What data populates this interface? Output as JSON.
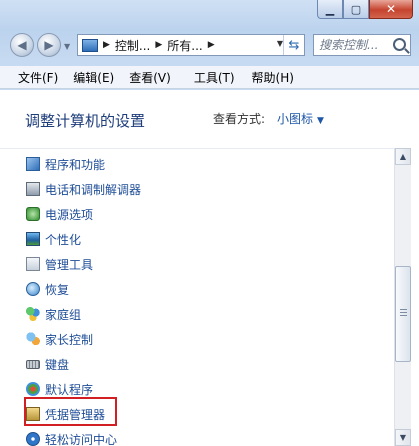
{
  "window": {
    "caption_icons": [
      "minimize-icon",
      "maximize-icon",
      "close-icon"
    ]
  },
  "nav": {
    "back_icon": "back-arrow-icon",
    "forward_icon": "forward-arrow-icon",
    "breadcrumbs": [
      "控制...",
      "所有..."
    ],
    "search_placeholder": "搜索控制..."
  },
  "menu": {
    "items": [
      "文件(F)",
      "编辑(E)",
      "查看(V)",
      "工具(T)",
      "帮助(H)"
    ]
  },
  "content": {
    "heading": "调整计算机的设置",
    "view_label": "查看方式:",
    "view_value": "小图标"
  },
  "list": {
    "items": [
      {
        "label": "程序和功能",
        "icon": "programs-features-icon",
        "color": "#4a7fc1"
      },
      {
        "label": "电话和调制解调器",
        "icon": "phone-modem-icon",
        "color": "#6b7d91"
      },
      {
        "label": "电源选项",
        "icon": "power-options-icon",
        "color": "#3a9a3a"
      },
      {
        "label": "个性化",
        "icon": "personalization-icon",
        "color": "#3b8fd8"
      },
      {
        "label": "管理工具",
        "icon": "admin-tools-icon",
        "color": "#8a9ab0"
      },
      {
        "label": "恢复",
        "icon": "recovery-icon",
        "color": "#2f7fc8"
      },
      {
        "label": "家庭组",
        "icon": "homegroup-icon",
        "color": "#2c9b4b"
      },
      {
        "label": "家长控制",
        "icon": "parental-controls-icon",
        "color": "#3c8ad6"
      },
      {
        "label": "键盘",
        "icon": "keyboard-icon",
        "color": "#7d8790"
      },
      {
        "label": "默认程序",
        "icon": "default-programs-icon",
        "color": "#4aa043"
      },
      {
        "label": "凭据管理器",
        "icon": "credential-manager-icon",
        "color": "#b8963a"
      },
      {
        "label": "轻松访问中心",
        "icon": "ease-of-access-icon",
        "color": "#2f75c8"
      }
    ]
  },
  "highlight_color": "#d11f24"
}
